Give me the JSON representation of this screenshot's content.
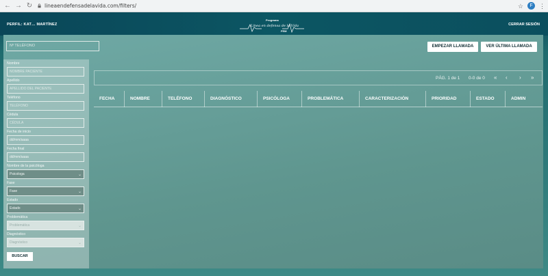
{
  "browser": {
    "url": "lineaendefensadelavida.com/filters/",
    "avatar_letter": "F"
  },
  "header": {
    "perfil": "PERFIL: KAT… MARTÍNEZ",
    "logo_line1": "Programa",
    "logo_line2": "Línea en defensa de la Vida",
    "logo_line3": "FEM",
    "logout": "CERRAR SESIÓN"
  },
  "toolbar": {
    "phone_placeholder": "Nº TELÉFONO",
    "start_call": "EMPEZAR LLAMADA",
    "last_call": "VER ÚLTIMA LLAMADA"
  },
  "filters": {
    "nombre_label": "Nombre",
    "nombre_placeholder": "NOMBRE PACIENTE",
    "apellido_label": "Apellido",
    "apellido_placeholder": "APELLIDO DEL PACIENTE",
    "telefono_label": "Teléfono",
    "telefono_placeholder": "TELÉFONO",
    "cedula_label": "Cédula",
    "cedula_placeholder": "CÉDULA",
    "fecha_inicio_label": "Fecha de inicio",
    "fecha_inicio_value": "dd/mm/aaaa",
    "fecha_final_label": "Fecha final",
    "fecha_final_value": "dd/mm/aaaa",
    "psicologa_label": "Nombre de la psicóloga",
    "psicologa_value": "Psicologa",
    "fase_label": "Fase",
    "fase_value": "Fase",
    "estado_label": "Estado",
    "estado_value": "Estado",
    "problematica_label": "Problemática",
    "problematica_value": "Problemática",
    "diagnostico_label": "Diagnóstico",
    "diagnostico_value": "Diagnóstico",
    "buscar": "BUSCAR"
  },
  "pager": {
    "page": "PÁG. 1 de 1",
    "count": "0-0 de 0"
  },
  "table": {
    "columns": [
      "FECHA",
      "NOMBRE",
      "TELÉFONO",
      "DIAGNÓSTICO",
      "PSICÓLOGA",
      "PROBLEMÁTICA",
      "CARACTERIZACIÓN",
      "PRIORIDAD",
      "ESTADO",
      "ADMIN"
    ]
  }
}
